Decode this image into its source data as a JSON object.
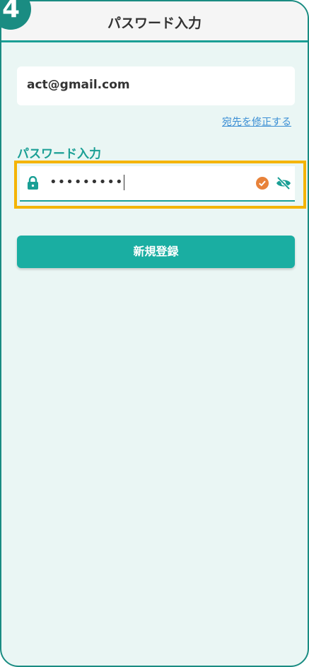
{
  "step_badge": "4",
  "header": {
    "title": "パスワード入力"
  },
  "email": {
    "value": "act@gmail.com"
  },
  "edit_link": {
    "label": "宛先を修正する"
  },
  "password": {
    "label": "パスワード入力",
    "value": "•••••••••",
    "valid": true,
    "visibility": "hidden"
  },
  "register_button": {
    "label": "新規登録"
  },
  "icons": {
    "lock": "lock-icon",
    "check": "check-circle-icon",
    "visibility_toggle": "eye-off-icon"
  },
  "colors": {
    "primary": "#1aaea2",
    "frame": "#1a8c82",
    "highlight": "#f4b400",
    "check": "#e8823a",
    "link": "#3a8ed4"
  }
}
